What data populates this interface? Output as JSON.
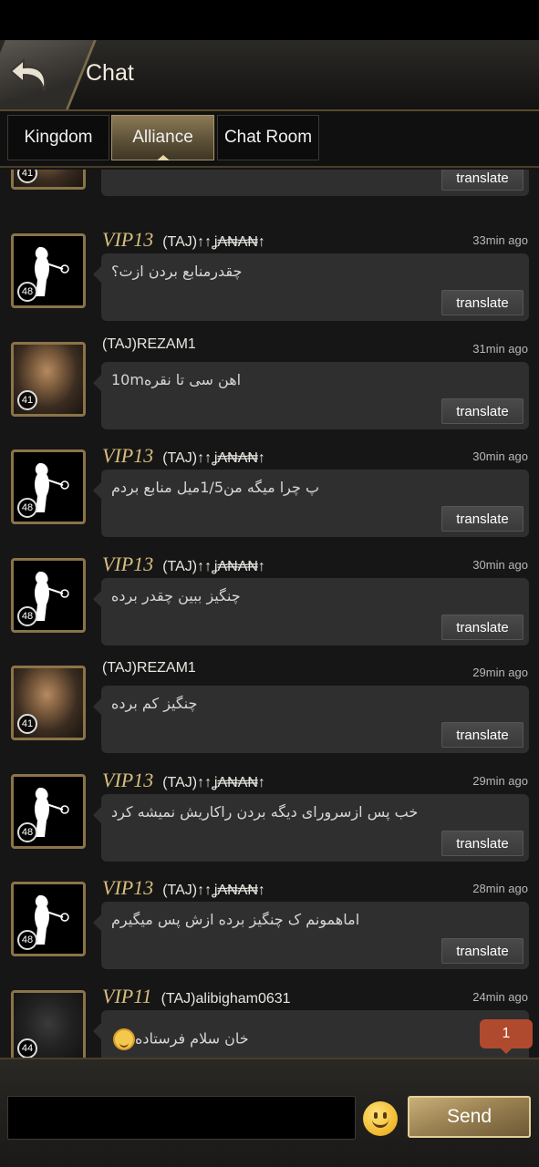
{
  "header": {
    "title": "Chat"
  },
  "tabs": [
    {
      "label": "Kingdom",
      "active": false
    },
    {
      "label": "Alliance",
      "active": true
    },
    {
      "label": "Chat Room",
      "active": false
    }
  ],
  "messages": [
    {
      "vip": "",
      "name": "",
      "time": "",
      "text": "",
      "level": "41",
      "avatar": "warrior-portrait",
      "translate": "translate"
    },
    {
      "vip": "VIP13",
      "name": "(TAJ)↑↑ʝ₳₦₳₦↑",
      "time": "33min ago",
      "text": "چقدرمنابع بردن ازت؟",
      "level": "48",
      "avatar": "white-figure",
      "translate": "translate"
    },
    {
      "vip": "",
      "name": "(TAJ)REZAM1",
      "time": "31min ago",
      "text": "10mاهن سی تا نقره",
      "level": "41",
      "avatar": "warrior-portrait",
      "translate": "translate"
    },
    {
      "vip": "VIP13",
      "name": "(TAJ)↑↑ʝ₳₦₳₦↑",
      "time": "30min ago",
      "text": "پ چرا میگه من1/5میل منابع بردم",
      "level": "48",
      "avatar": "white-figure",
      "translate": "translate"
    },
    {
      "vip": "VIP13",
      "name": "(TAJ)↑↑ʝ₳₦₳₦↑",
      "time": "30min ago",
      "text": "چنگیز ببین چقدر برده",
      "level": "48",
      "avatar": "white-figure",
      "translate": "translate"
    },
    {
      "vip": "",
      "name": "(TAJ)REZAM1",
      "time": "29min ago",
      "text": "چنگیز کم برده",
      "level": "41",
      "avatar": "warrior-portrait",
      "translate": "translate"
    },
    {
      "vip": "VIP13",
      "name": "(TAJ)↑↑ʝ₳₦₳₦↑",
      "time": "29min ago",
      "text": "خب پس ازسرورای دیگه بردن راکاریش نمیشه کرد",
      "level": "48",
      "avatar": "white-figure",
      "translate": "translate"
    },
    {
      "vip": "VIP13",
      "name": "(TAJ)↑↑ʝ₳₦₳₦↑",
      "time": "28min ago",
      "text": "اماهمونم ک چنگیز برده ازش پس میگیرم",
      "level": "48",
      "avatar": "white-figure",
      "translate": "translate"
    },
    {
      "vip": "VIP11",
      "name": "(TAJ)alibigham0631",
      "time": "24min ago",
      "text": "خان سلام فرستاده",
      "level": "44",
      "avatar": "hooded-portrait",
      "translate": ""
    }
  ],
  "unread_badge": "1",
  "composer": {
    "input_value": "",
    "send_label": "Send"
  }
}
